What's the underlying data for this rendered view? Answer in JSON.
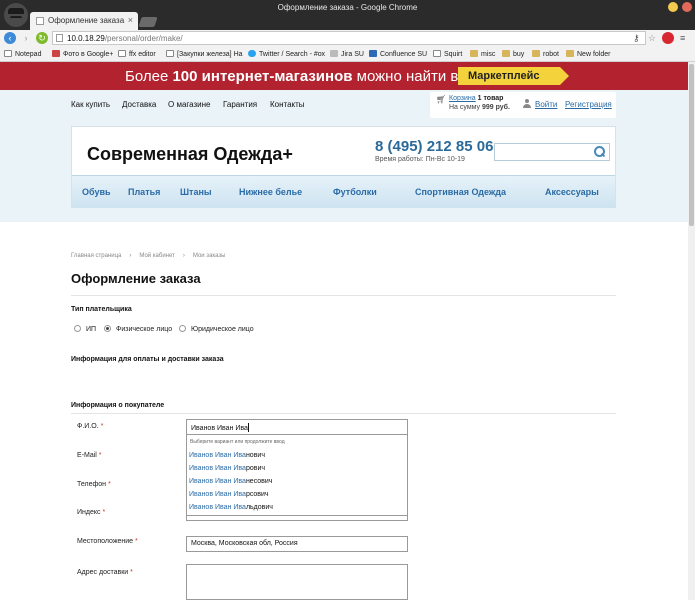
{
  "window": {
    "title": "Оформление заказа - Google Chrome"
  },
  "tab": {
    "title": "Оформление заказа",
    "close": "×"
  },
  "address_bar": {
    "host": "10.0.18.29",
    "path": "/personal/order/make/"
  },
  "bookmarks": [
    {
      "label": "Notepad",
      "icon": "file-icon"
    },
    {
      "label": "Фото в Google+",
      "icon": "google-plus-icon"
    },
    {
      "label": "ffx editor",
      "icon": "file-icon"
    },
    {
      "label": "[Закупки железа] Ha",
      "icon": "file-icon"
    },
    {
      "label": "Twitter / Search - #ох",
      "icon": "twitter-icon"
    },
    {
      "label": "Jira SU",
      "icon": "file-icon"
    },
    {
      "label": "Confluence SU",
      "icon": "confluence-icon"
    },
    {
      "label": "Squirt",
      "icon": "file-icon"
    },
    {
      "label": "misc",
      "icon": "folder-icon"
    },
    {
      "label": "buy",
      "icon": "folder-icon"
    },
    {
      "label": "robot",
      "icon": "folder-icon"
    },
    {
      "label": "New folder",
      "icon": "folder-icon"
    }
  ],
  "banner": {
    "pre": "Более ",
    "num": "100 интернет-магазинов",
    "post": " можно найти в",
    "button": "Маркетплейс"
  },
  "topnav": [
    "Как купить",
    "Доставка",
    "О магазине",
    "Гарантия",
    "Контакты"
  ],
  "cart": {
    "link": "Корзина",
    "count": "1 товар",
    "sum_pre": "На сумму",
    "sum": "999 руб."
  },
  "auth": {
    "login": "Войти",
    "register": "Регистрация"
  },
  "shop": {
    "name": "Современная Одежда+",
    "phone": "8 (495) 212 85 06",
    "hours": "Время работы: Пн-Вс 10-19"
  },
  "categories": [
    "Обувь",
    "Платья",
    "Штаны",
    "Нижнее белье",
    "Футболки",
    "Спортивная Одежда",
    "Аксессуары"
  ],
  "breadcrumb": [
    "Главная страница",
    "›",
    "Мой кабинет",
    "›",
    "Мои заказы"
  ],
  "page_title": "Оформление заказа",
  "payer": {
    "label": "Тип плательщика",
    "options": [
      {
        "label": "ИП",
        "selected": false
      },
      {
        "label": "Физическое лицо",
        "selected": true
      },
      {
        "label": "Юридическое лицо",
        "selected": false
      }
    ]
  },
  "sections": {
    "payment": "Информация для оплаты и доставки заказа",
    "buyer": "Информация о покупателе"
  },
  "fields": {
    "fio": {
      "label": "Ф.И.О.",
      "value": "Иванов Иван Ива"
    },
    "email": {
      "label": "E-Mail"
    },
    "phone": {
      "label": "Телефон"
    },
    "index": {
      "label": "Индекс"
    },
    "location": {
      "label": "Местоположение",
      "value": "Москва, Московская обл, Россия"
    },
    "address": {
      "label": "Адрес доставки"
    },
    "required_mark": "*"
  },
  "suggest": {
    "hint": "Выберите вариант или продолжите ввод",
    "match": "Иванов Иван Ива",
    "items": [
      {
        "match": "Иванов Иван Ива",
        "rest": "нович"
      },
      {
        "match": "Иванов Иван Ива",
        "rest": "рович"
      },
      {
        "match": "Иванов Иван Ива",
        "rest": "несович"
      },
      {
        "match": "Иванов Иван Ива",
        "rest": "рсович"
      },
      {
        "match": "Иванов Иван Ива",
        "rest": "льдович"
      }
    ]
  },
  "colors": {
    "banner": "#b2232f",
    "button": "#f4d23b",
    "link": "#2a6ba6",
    "phone": "#2a6a9a"
  }
}
